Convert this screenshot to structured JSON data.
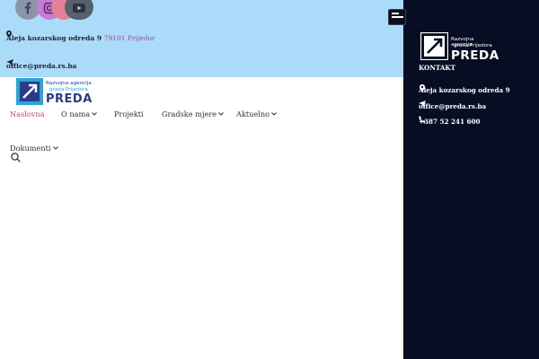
{
  "topbar": {
    "social": [
      "facebook-icon",
      "instagram-icon",
      "pinterest-icon",
      "youtube-icon"
    ],
    "address_street": "Aleja kozarskog odreda 9",
    "address_city": "79101 Prijedor",
    "email": "office@preda.rs.ba"
  },
  "logo": {
    "line1": "Razvojna agencija",
    "line2": "grada Prijedora",
    "line3": "PREDA"
  },
  "nav": {
    "items": [
      {
        "label": "Naslovna",
        "active": true,
        "dropdown": false
      },
      {
        "label": "O nama",
        "active": false,
        "dropdown": true
      },
      {
        "label": "Projekti",
        "active": false,
        "dropdown": false
      },
      {
        "label": "Gradske mjere",
        "active": false,
        "dropdown": true
      },
      {
        "label": "Aktuelno",
        "active": false,
        "dropdown": true
      },
      {
        "label": "Dokumenti",
        "active": false,
        "dropdown": true
      }
    ]
  },
  "panel": {
    "title": "KONTAKT",
    "address": "Aleja kozarskog odreda 9",
    "email": "office@preda.rs.ba",
    "phone": "+387 52 241 600"
  },
  "colors": {
    "topbar_bg": "#aadcfa",
    "panel_bg": "#070d22",
    "accent": "#b5457e",
    "brand_blue": "#2b3a8a",
    "brand_light": "#2aa4d8"
  }
}
